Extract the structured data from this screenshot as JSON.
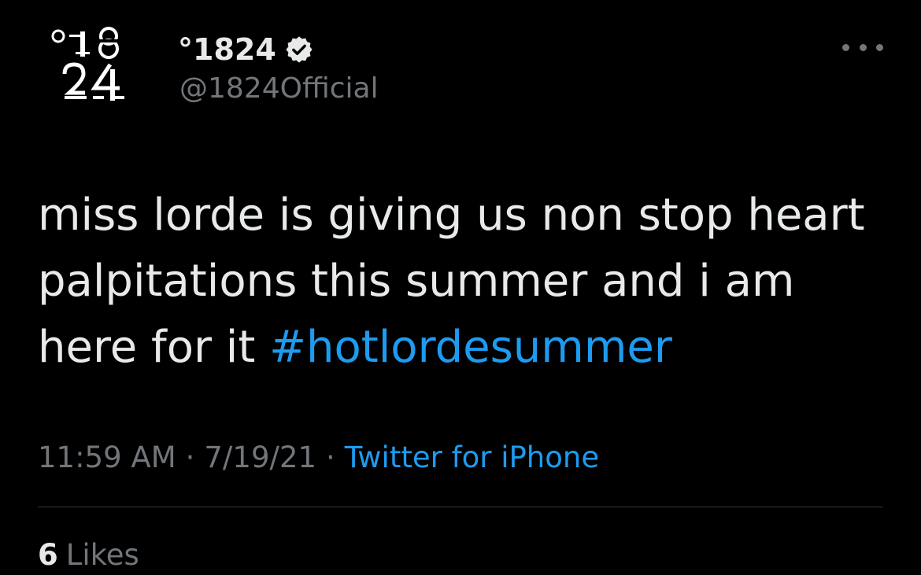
{
  "colors": {
    "background": "#000000",
    "primary_text": "#e7e9ea",
    "secondary_text": "#71767b",
    "accent": "#1d9bf0",
    "divider": "#2f3336"
  },
  "author": {
    "avatar_icon": "1824-logo-icon",
    "avatar_text_top": "°18",
    "avatar_text_bottom": "24",
    "display_name": "°1824",
    "verified_icon": "verified-badge-icon",
    "handle": "@1824Official"
  },
  "more_icon": "more-horizontal-icon",
  "tweet": {
    "lines": [
      "miss lorde is giving us non stop heart",
      "palpitations this summer and i am",
      "here for it "
    ],
    "hashtag": "#hotlordesummer"
  },
  "meta": {
    "time": "11:59 AM",
    "separator": "·",
    "date": "7/19/21",
    "source": "Twitter for iPhone"
  },
  "stats": {
    "likes_count": "6",
    "likes_label": "Likes"
  }
}
